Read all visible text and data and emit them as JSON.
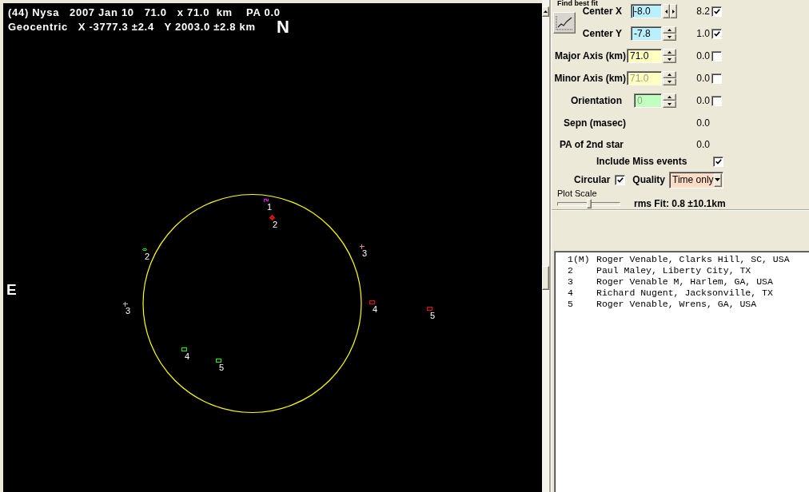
{
  "plot": {
    "title_line": "(44) Nysa   2007 Jan 10   71.0   x 71.0  km    PA 0.0",
    "position_line": "Geocentric   X -3777.3 ±2.4   Y 2003.0 ±2.8 km",
    "north_label": "N",
    "east_label": "E",
    "events": [
      {
        "label": "1",
        "kind": "tick",
        "color": "#ff00ff"
      },
      {
        "label": "2",
        "kind": "diamond",
        "color": "#ff0000"
      },
      {
        "label": "3",
        "kind": "plus",
        "color": "#e08080"
      },
      {
        "label": "2",
        "kind": "ring",
        "color": "#00ff00"
      },
      {
        "label": "4",
        "kind": "square",
        "color": "#ff0000"
      },
      {
        "label": "3",
        "kind": "plus",
        "color": "#a0c0a0"
      },
      {
        "label": "5",
        "kind": "square",
        "color": "#ff0000"
      },
      {
        "label": "4",
        "kind": "square",
        "color": "#00ff00"
      },
      {
        "label": "5",
        "kind": "square",
        "color": "#00ff00"
      }
    ]
  },
  "fit_panel": {
    "title": "Find best fit",
    "parameters": [
      {
        "label": "Center X",
        "value": "-8.0",
        "color": "#b8f0ff",
        "disabled": false,
        "focused": true,
        "kind": "horizontal",
        "residual": "8.2",
        "checked": true
      },
      {
        "label": "Center Y",
        "value": "-7.8",
        "color": "#b8f0ff",
        "disabled": false,
        "focused": false,
        "kind": "vertical",
        "residual": "1.0",
        "checked": true
      },
      {
        "label": "Major Axis (km)",
        "value": "71.0",
        "color": "#ffffc0",
        "disabled": false,
        "focused": false,
        "kind": "vertical",
        "residual": "0.0",
        "checked": false
      },
      {
        "label": "Minor Axis (km)",
        "value": "71.0",
        "color": "#ffffc0",
        "disabled": true,
        "focused": false,
        "kind": "vertical",
        "residual": "0.0",
        "checked": false
      },
      {
        "label": "Orientation",
        "value": "0",
        "color": "#c0ffc0",
        "disabled": true,
        "focused": false,
        "kind": "vertical",
        "residual": "0.0",
        "checked": false
      }
    ],
    "readouts": [
      {
        "label": "Sepn (masec)",
        "value": "0.0"
      },
      {
        "label": "PA of 2nd star",
        "value": "0.0"
      }
    ],
    "include_miss": {
      "label": "Include Miss events",
      "checked": true
    },
    "circular": {
      "label": "Circular",
      "checked": true
    },
    "quality": {
      "label": "Quality",
      "value": "Time only"
    },
    "plot_scale": {
      "label": "Plot Scale",
      "level": 0.5
    },
    "rms_fit": "rms Fit: 0.8 ±10.1km"
  },
  "observers": [
    {
      "number": "1(M)",
      "name": "Roger Venable, Clarks Hill, SC, USA"
    },
    {
      "number": "2",
      "name": "Paul Maley, Liberty City, TX"
    },
    {
      "number": "3",
      "name": "Roger Venable M, Harlem, GA, USA"
    },
    {
      "number": "4",
      "name": "Richard Nugent, Jacksonville, TX"
    },
    {
      "number": "5",
      "name": "Roger Venable, Wrens, GA, USA"
    }
  ]
}
